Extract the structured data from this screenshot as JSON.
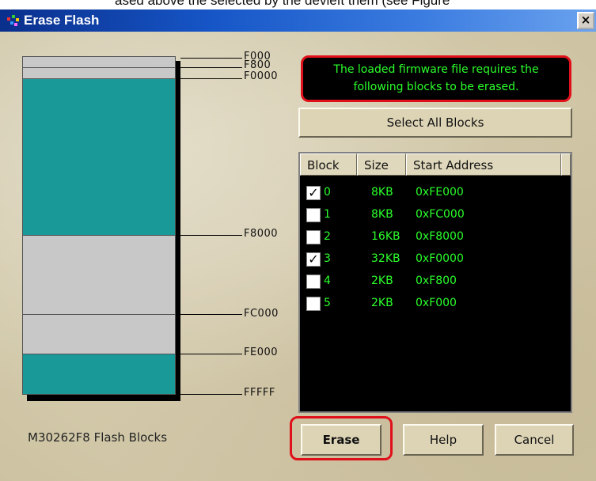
{
  "window": {
    "title": "Erase Flash",
    "close_label": "×",
    "top_strip_text": "ased above the selected by the devleft them (see Figure"
  },
  "memory_map": {
    "chip_label": "M30262F8 Flash Blocks",
    "address_labels": [
      "F000",
      "F800",
      "F0000",
      "F8000",
      "FC000",
      "FE000",
      "FFFFF"
    ],
    "colors": {
      "selected": "#1a9999",
      "unselected": "#c8c8c8",
      "shadow": "#000000"
    }
  },
  "message": {
    "line1": "The loaded firmware file requires the",
    "line2": "following blocks to be erased."
  },
  "buttons": {
    "select_all": "Select All Blocks",
    "erase": "Erase",
    "help": "Help",
    "cancel": "Cancel"
  },
  "block_list": {
    "columns": [
      "Block",
      "Size",
      "Start Address"
    ],
    "rows": [
      {
        "block": "0",
        "size": "8KB",
        "start": "0xFE000",
        "checked": true,
        "check_mark": "✓"
      },
      {
        "block": "1",
        "size": "8KB",
        "start": "0xFC000",
        "checked": false,
        "check_mark": ""
      },
      {
        "block": "2",
        "size": "16KB",
        "start": "0xF8000",
        "checked": false,
        "check_mark": ""
      },
      {
        "block": "3",
        "size": "32KB",
        "start": "0xF0000",
        "checked": true,
        "check_mark": "✓"
      },
      {
        "block": "4",
        "size": "2KB",
        "start": "0xF800",
        "checked": false,
        "check_mark": ""
      },
      {
        "block": "5",
        "size": "2KB",
        "start": "0xF000",
        "checked": false,
        "check_mark": ""
      }
    ]
  },
  "colors": {
    "highlight": "#e0101a",
    "list_text": "#2bff2b",
    "list_bg": "#000000"
  }
}
